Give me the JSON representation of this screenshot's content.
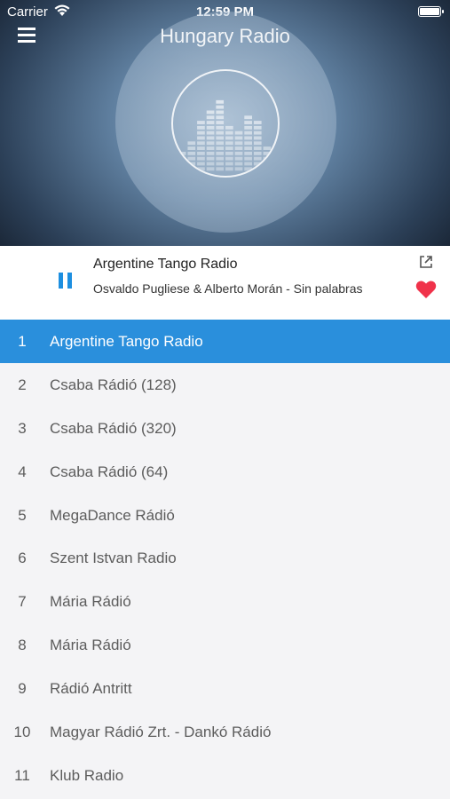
{
  "status_bar": {
    "carrier": "Carrier",
    "time": "12:59 PM"
  },
  "header": {
    "title": "Hungary Radio",
    "menu_icon": "hamburger-icon"
  },
  "player": {
    "station": "Argentine Tango Radio",
    "track": "Osvaldo Pugliese & Alberto Morán - Sin palabras",
    "state": "playing",
    "icons": {
      "pause": "pause-icon",
      "share": "share-icon",
      "favorite": "heart-icon"
    },
    "favorite_color": "#f0324a",
    "accent_color": "#1d8fe0"
  },
  "stations": [
    {
      "num": "1",
      "name": "Argentine Tango Radio",
      "active": true
    },
    {
      "num": "2",
      "name": "Csaba Rádió (128)"
    },
    {
      "num": "3",
      "name": "Csaba Rádió (320)"
    },
    {
      "num": "4",
      "name": "Csaba Rádió (64)"
    },
    {
      "num": "5",
      "name": "MegaDance Rádió"
    },
    {
      "num": "6",
      "name": "Szent Istvan Radio"
    },
    {
      "num": "7",
      "name": "Mária Rádió"
    },
    {
      "num": "8",
      "name": "Mária Rádió"
    },
    {
      "num": "9",
      "name": "Rádió Antritt"
    },
    {
      "num": "10",
      "name": "Magyar Rádió Zrt. - Dankó Rádió"
    },
    {
      "num": "11",
      "name": "Klub Radio"
    }
  ],
  "list_active_color": "#2a8fdc"
}
